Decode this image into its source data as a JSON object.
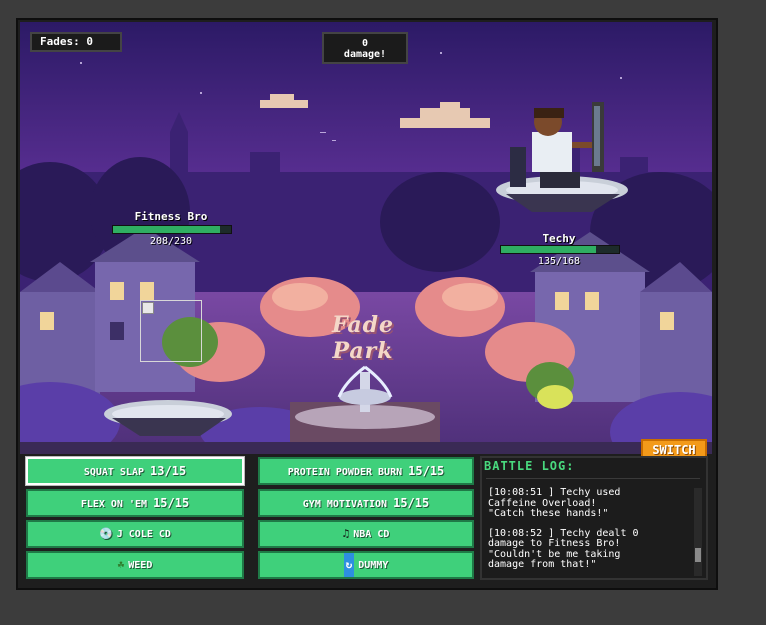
{
  "hud": {
    "fades_label": "Fades: 0",
    "damage_line1": "0",
    "damage_line2": "damage!"
  },
  "scene": {
    "location_title": "Fade Park"
  },
  "player": {
    "name": "Fitness Bro",
    "hp_text": "208/230",
    "hp_current": 208,
    "hp_max": 230
  },
  "enemy": {
    "name": "Techy",
    "hp_text": "135/168",
    "hp_current": 135,
    "hp_max": 168
  },
  "switch_label": "SWITCH",
  "moves": [
    {
      "label": "SQUAT SLAP ",
      "pp": "13/15"
    },
    {
      "label": "PROTEIN POWDER BURN ",
      "pp": "15/15"
    },
    {
      "label": "FLEX ON 'EM ",
      "pp": "15/15"
    },
    {
      "label": "GYM MOTIVATION ",
      "pp": "15/15"
    }
  ],
  "items": [
    {
      "label": "J COLE CD",
      "icon": "cd-icon"
    },
    {
      "label": "NBA CD",
      "icon": "music-note-icon"
    },
    {
      "label": "WEED",
      "icon": "leaf-icon"
    },
    {
      "label": "DUMMY",
      "icon": "refresh-icon"
    }
  ],
  "log": {
    "title": "BATTLE LOG:",
    "entries": [
      "[10:08:51 ] Techy used\nCaffeine Overload!\n\"Catch these hands!\"",
      "[10:08:52 ] Techy dealt 0\ndamage to Fitness Bro!\n\"Couldn't be me taking\ndamage from that!\""
    ]
  },
  "colors": {
    "button_green": "#3fd07b",
    "switch_orange": "#f39a1a",
    "log_title_green": "#49d97e",
    "hp_green": "#2fae62"
  }
}
